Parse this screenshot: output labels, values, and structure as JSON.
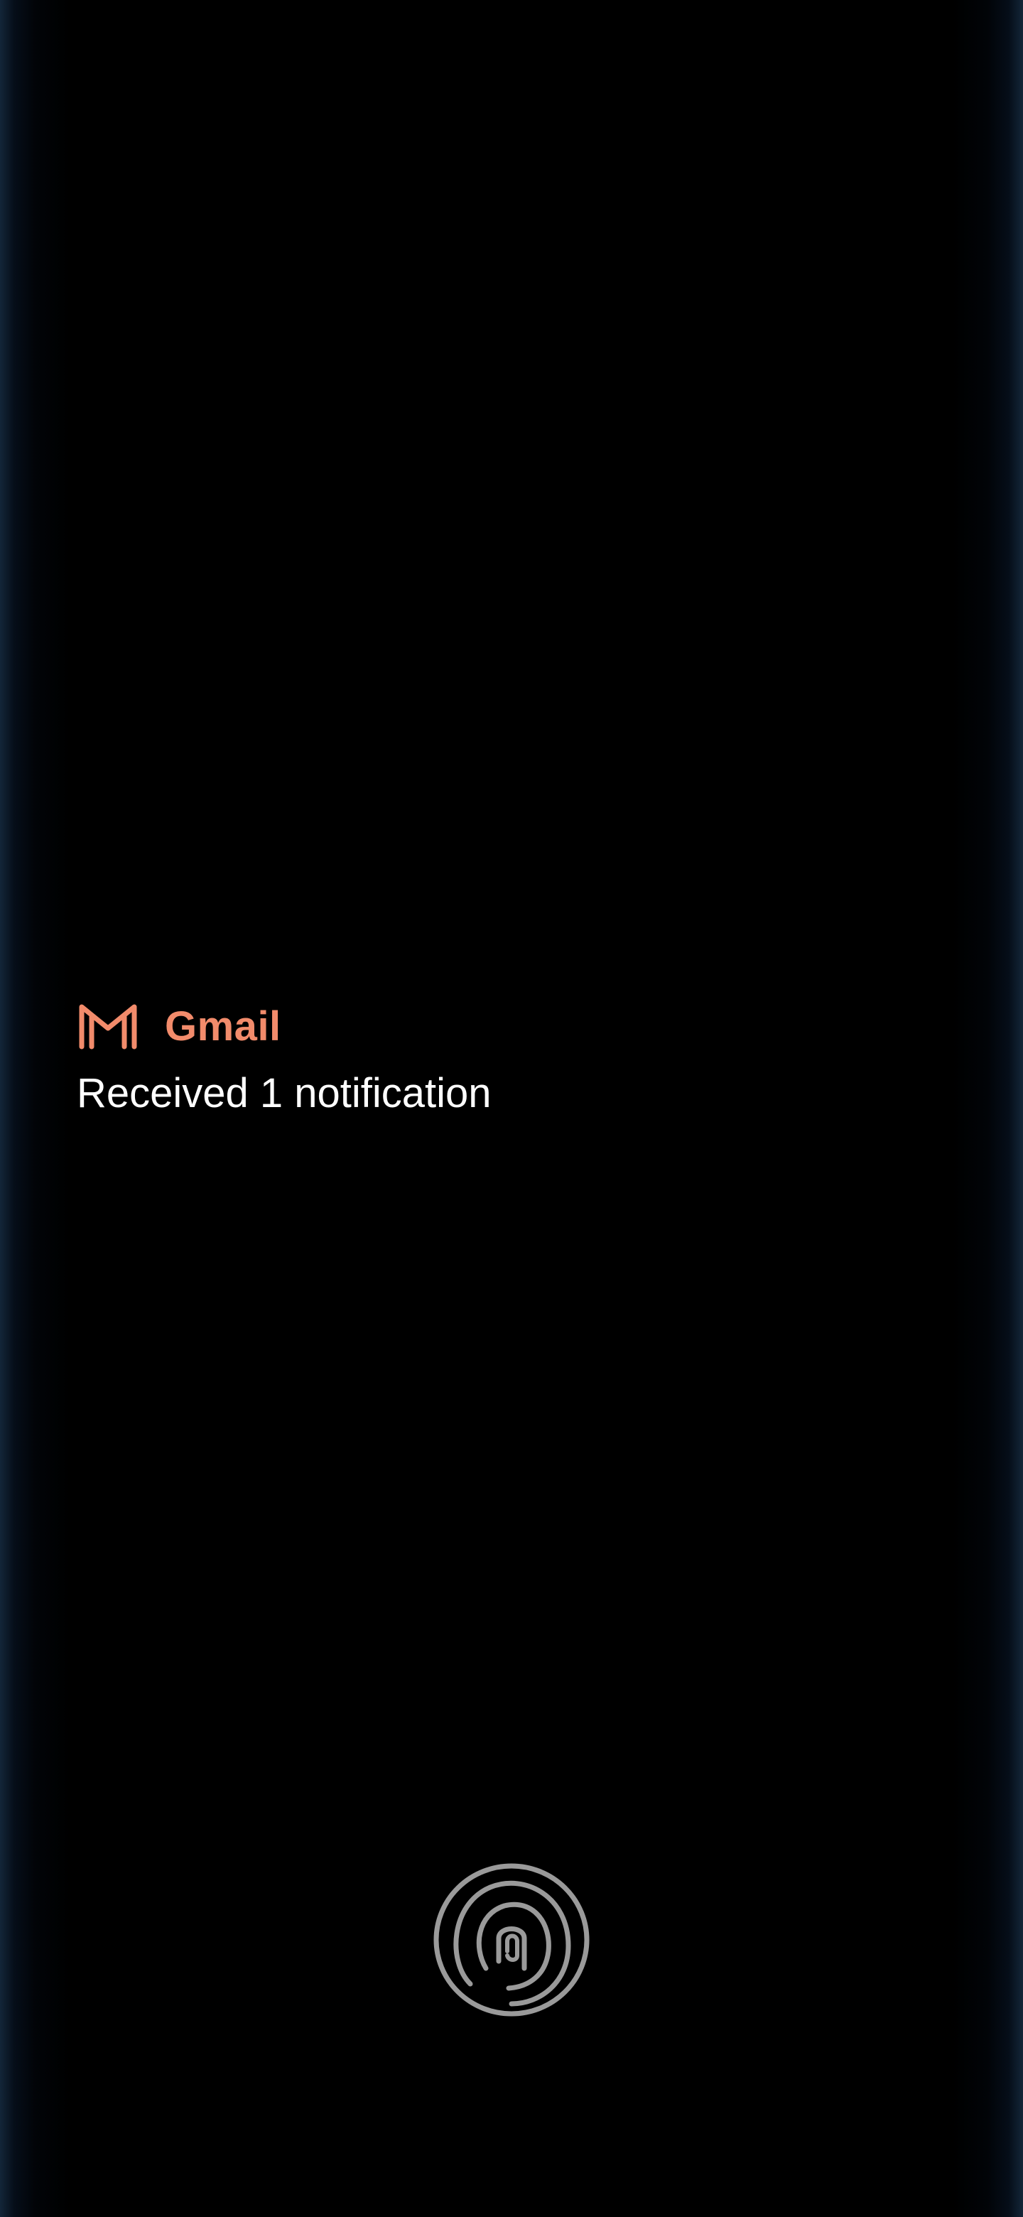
{
  "notification": {
    "app_name": "Gmail",
    "app_icon": "gmail-icon",
    "message": "Received 1 notification",
    "accent_color": "#f28b6b"
  },
  "lock": {
    "icon": "fingerprint-icon",
    "icon_color": "#9a9a9a"
  },
  "theme": {
    "background": "#000000",
    "edge_glow": "#142a3c"
  }
}
